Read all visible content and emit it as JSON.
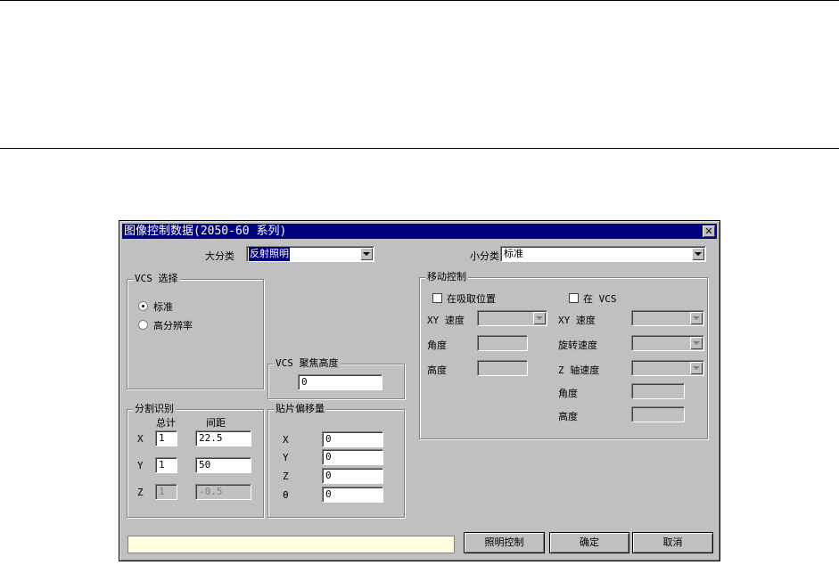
{
  "dialog": {
    "title": "图像控制数据(2050-60 系列)",
    "close_glyph": "✕",
    "major_category": {
      "label": "大分类",
      "value": "反射照明"
    },
    "minor_category": {
      "label": "小分类",
      "value": "标准"
    },
    "vcs_select": {
      "legend": "VCS 选择",
      "options": [
        "标准",
        "高分辨率"
      ],
      "selected": "标准"
    },
    "vcs_focus": {
      "legend": "VCS 聚焦高度",
      "value": "0"
    },
    "segmentation": {
      "legend": "分割识别",
      "col_total": "总计",
      "col_spacing": "间距",
      "rows": [
        {
          "axis": "X",
          "total": "1",
          "spacing": "22.5",
          "disabled": false
        },
        {
          "axis": "Y",
          "total": "1",
          "spacing": "50",
          "disabled": false
        },
        {
          "axis": "Z",
          "total": "1",
          "spacing": "-0.5",
          "disabled": true
        }
      ]
    },
    "chip_offset": {
      "legend": "贴片偏移量",
      "rows": [
        {
          "axis": "X",
          "value": "0"
        },
        {
          "axis": "Y",
          "value": "0"
        },
        {
          "axis": "Z",
          "value": "0"
        },
        {
          "axis": "θ",
          "value": "0"
        }
      ]
    },
    "motion_control": {
      "legend": "移动控制",
      "at_pick_position": "在吸取位置",
      "at_vcs": "在 VCS",
      "left": {
        "xy_speed": "XY 速度",
        "angle": "角度",
        "height": "高度"
      },
      "right": {
        "xy_speed": "XY 速度",
        "rotation_speed": "旋转速度",
        "z_speed": "Z 轴速度",
        "angle": "角度",
        "height": "高度"
      }
    },
    "buttons": {
      "lighting": "照明控制",
      "ok": "确定",
      "cancel": "取消"
    },
    "status_text": ""
  }
}
